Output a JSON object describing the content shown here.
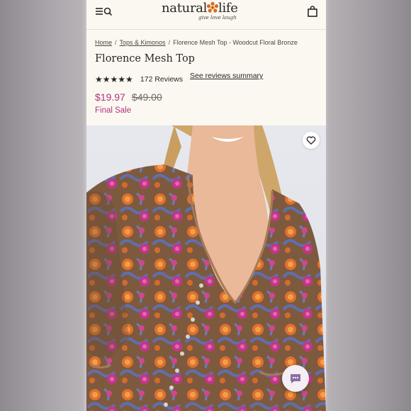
{
  "header": {
    "logo_word_1": "natural",
    "logo_word_2": "life",
    "logo_tagline": "give love laugh",
    "menu_icon": "menu-icon",
    "search_icon": "search-icon",
    "cart_icon": "shopping-bag-icon"
  },
  "breadcrumb": {
    "items": [
      {
        "label": "Home",
        "link": true
      },
      {
        "label": "Tops & Kimonos",
        "link": true
      },
      {
        "label": "Florence Mesh Top - Woodcut Floral Bronze",
        "link": false
      }
    ],
    "separator": "/"
  },
  "product": {
    "title": "Florence Mesh Top",
    "stars": "★★★★★",
    "rating_value": 5,
    "review_count": "172 Reviews",
    "reviews_summary_link": "See reviews summary",
    "sale_price": "$19.97",
    "original_price": "$49.00",
    "sale_note": "Final Sale"
  },
  "image": {
    "wishlist_icon": "heart-icon",
    "chat_icon": "chat-bubble-icon"
  },
  "colors": {
    "sale": "#b0337a",
    "text": "#2a2520",
    "page_bg": "#fbf8f2"
  }
}
